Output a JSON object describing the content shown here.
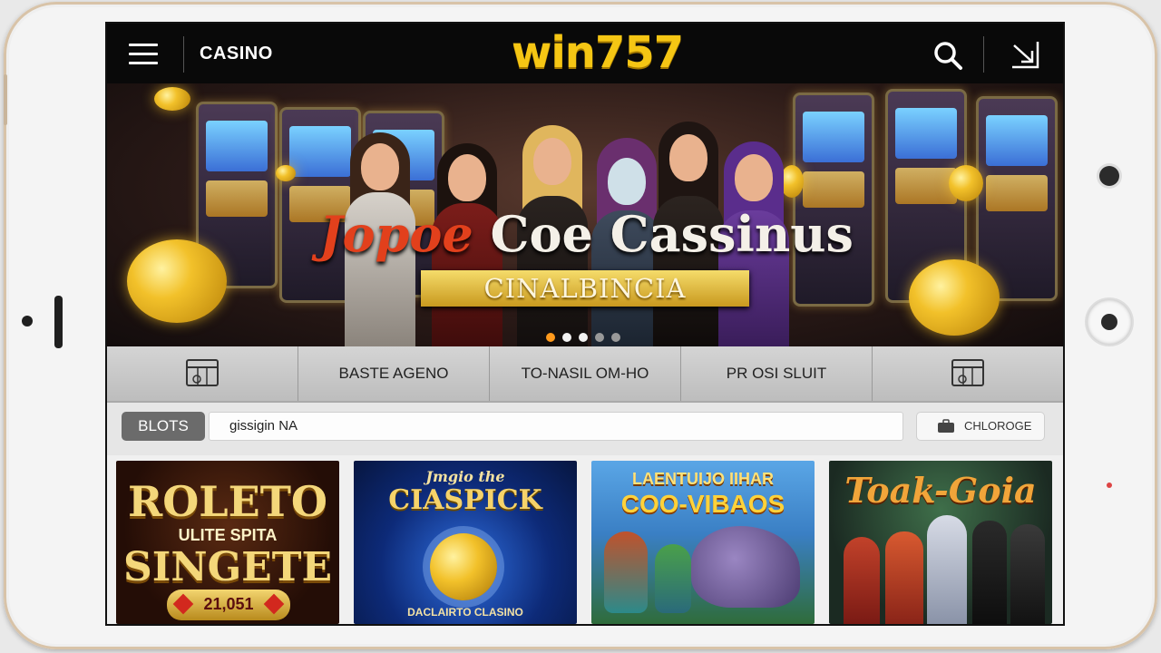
{
  "header": {
    "section_label": "CASINO",
    "logo": "win757",
    "menu_icon": "hamburger-menu-icon",
    "search_icon": "search-icon",
    "login_icon": "login-arrow-icon"
  },
  "banner": {
    "title_part1": "Jopoe",
    "title_part2": " Coe Cassinus",
    "subtitle": "CINALBINCIA",
    "active_slide": 1,
    "slide_count": 5
  },
  "nav": {
    "items": [
      {
        "icon": "slot-machine-icon",
        "label": ""
      },
      {
        "label": "BASTE AGENO"
      },
      {
        "label": "TO-NASIL OM-HO"
      },
      {
        "label": "PR OSI SLUIT"
      },
      {
        "icon": "slot-machine-icon",
        "label": ""
      }
    ]
  },
  "filter": {
    "category_chip": "BLOTS",
    "search_value": "gissigin NA",
    "right_chip_label": "CHLOROGE",
    "right_chip_icon": "briefcase-icon"
  },
  "games": [
    {
      "title_line1": "ROLETO",
      "title_line2": "ULITE SPITA",
      "title_line3": "SINGETE",
      "amount": "21,051"
    },
    {
      "title_top": "Jmgio the",
      "title": "CIASPICK",
      "footer": "DACLAIRTO CLASINO"
    },
    {
      "title_line1": "LAENTUIJO IIHAR",
      "title_line2": "COO-VIBAOS"
    },
    {
      "title": "Toak-Goia"
    }
  ],
  "colors": {
    "brand_yellow": "#f5c614",
    "header_bg": "#090909",
    "dot_active": "#ff9a1c"
  }
}
